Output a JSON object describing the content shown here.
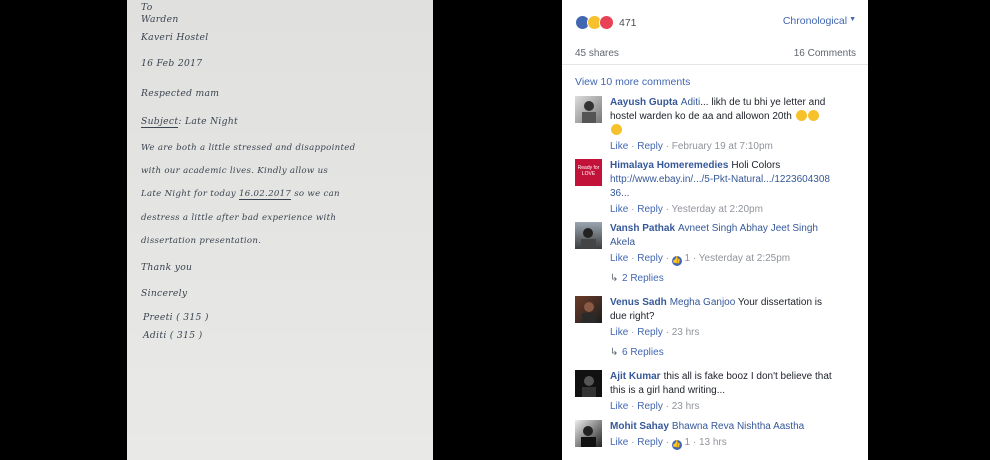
{
  "letter": {
    "lines": {
      "to": "To",
      "warden": "Warden",
      "hostel": "Kaveri Hostel",
      "date": "16 Feb 2017",
      "greeting": "Respected mam",
      "subject_label": "Subject",
      "subject_text": ": Late Night",
      "body1": "We   are   both   a   little   stressed   and   disappointed",
      "body2": "with   our   academic   lives.   Kindly   allow   us",
      "body3_a": "Late Night   for   today",
      "body3_date": "16.02.2017",
      "body3_b": "so   we  can",
      "body4": "destress   a  little   after   bad   experience   with",
      "body5": "dissertation   presentation.",
      "thanks": "Thank you",
      "sincerely": "Sincerely",
      "sign1": "Preeti  ( 315 )",
      "sign2": "Aditi   ( 315 )"
    }
  },
  "post": {
    "reaction_count": "471",
    "sort_label": "Chronological",
    "shares": "45 shares",
    "comments_count": "16 Comments",
    "view_more": "View 10 more comments",
    "like_label": "Like",
    "reply_label": "Reply",
    "colors": {
      "link": "#4267b2",
      "name": "#365899",
      "meta": "#90949c"
    }
  },
  "comments": [
    {
      "name": "Aayush Gupta",
      "tag": "Aditi",
      "text": "... likh de tu bhi ye letter and hostel warden ko de aa and allowon 20th",
      "time": "February 19 at 7:10pm"
    },
    {
      "name": "Himalaya Homeremedies",
      "tag": "",
      "text": "Holi Colors",
      "link": "http://www.ebay.in/.../5-Pkt-Natural.../122360430836...",
      "avatar_text": "Ready for LOVE",
      "time": "Yesterday at 2:20pm"
    },
    {
      "name": "Vansh Pathak",
      "tag": "Avneet Singh Abhay Jeet Singh Akela",
      "text": "",
      "likes": "1",
      "time": "Yesterday at 2:25pm",
      "replies": "2 Replies"
    },
    {
      "name": "Venus Sadh",
      "tag": "Megha Ganjoo",
      "text": "Your dissertation is due right?",
      "time": "23 hrs",
      "replies": "6 Replies"
    },
    {
      "name": "Ajit Kumar",
      "tag": "",
      "text": "this all is fake booz I don't believe that this is a girl hand writing...",
      "time": "23 hrs"
    },
    {
      "name": "Mohit Sahay",
      "tag": "Bhawna Reva Nishtha Aastha",
      "text": "",
      "likes": "1",
      "time": "13 hrs"
    }
  ]
}
